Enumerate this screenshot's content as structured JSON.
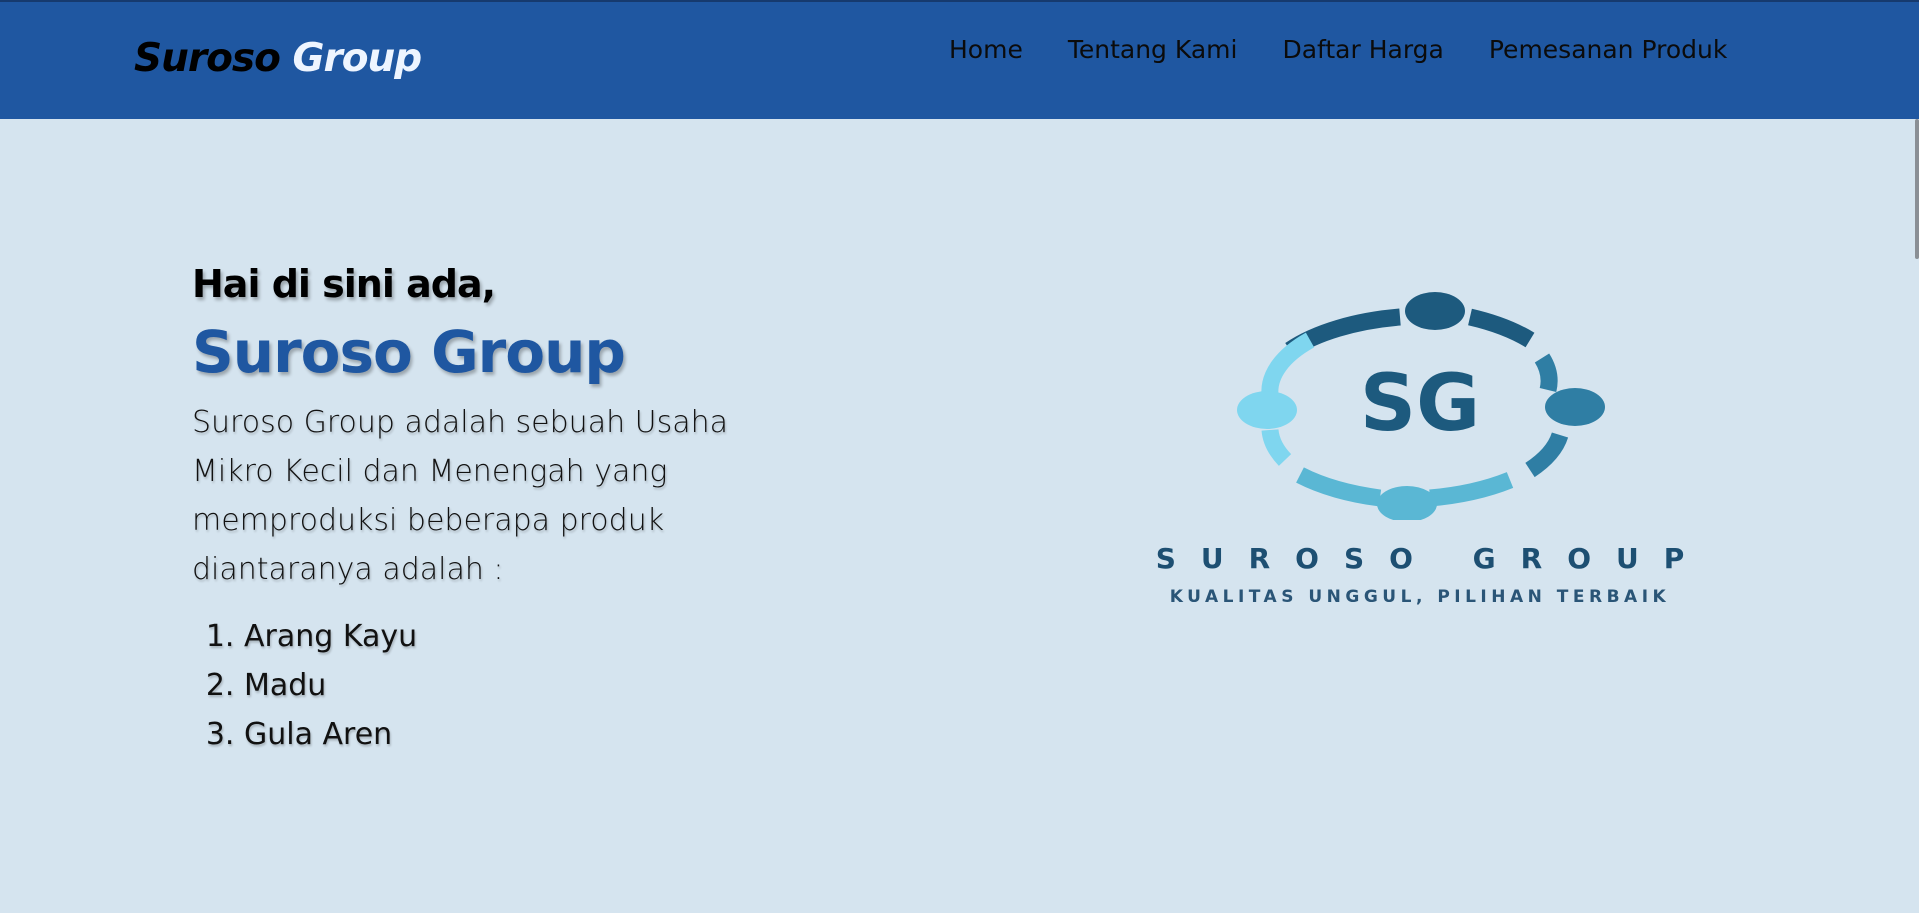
{
  "header": {
    "brand_first": "Suroso",
    "brand_second": "Group",
    "nav": [
      {
        "label": "Home"
      },
      {
        "label": "Tentang Kami"
      },
      {
        "label": "Daftar Harga"
      },
      {
        "label": "Pemesanan Produk"
      }
    ]
  },
  "hero": {
    "greeting": "Hai di sini ada,",
    "title": "Suroso Group",
    "description": "Suroso Group adalah sebuah Usaha Mikro Kecil dan Menengah yang memproduksi beberapa produk diantaranya adalah :",
    "products": [
      "Arang Kayu",
      "Madu",
      "Gula Aren"
    ]
  },
  "logo": {
    "monogram": "SG",
    "name": "SUROSO GROUP",
    "tagline": "KUALITAS UNGGUL, PILIHAN TERBAIK"
  },
  "colors": {
    "header_bg": "#1f57a1",
    "page_bg": "#d5e4ef",
    "accent": "#1f57a1",
    "logo_dark": "#1d5a7e",
    "logo_light": "#7fd6ef"
  }
}
